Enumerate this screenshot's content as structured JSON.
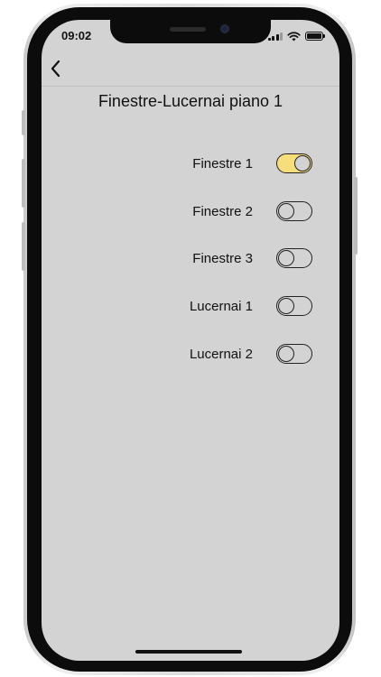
{
  "status_bar": {
    "time": "09:02"
  },
  "nav": {
    "back_icon": "chevron-left-icon"
  },
  "page": {
    "title": "Finestre-Lucernai piano 1"
  },
  "toggles": [
    {
      "label": "Finestre 1",
      "on": true
    },
    {
      "label": "Finestre 2",
      "on": false
    },
    {
      "label": "Finestre 3",
      "on": false
    },
    {
      "label": "Lucernai 1",
      "on": false
    },
    {
      "label": "Lucernai 2",
      "on": false
    }
  ],
  "colors": {
    "accent_on": "#f6de7a",
    "screen_background": "#d3d3d3"
  }
}
